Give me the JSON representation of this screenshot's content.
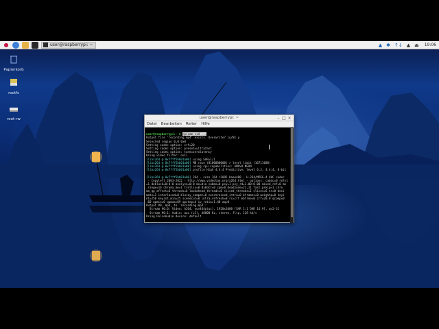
{
  "taskbar": {
    "task_label": "user@raspberrypi: ~",
    "clock": "19:06",
    "tray_icons": [
      "network-icon",
      "bluetooth-icon",
      "wifi-icon",
      "volume-icon",
      "eject-icon"
    ]
  },
  "desktop_icons": [
    {
      "label": "Papierkorb",
      "icon": "trash-icon"
    },
    {
      "label": "rootfs",
      "icon": "drive-icon"
    },
    {
      "label": "root-rw",
      "icon": "drive-icon"
    }
  ],
  "terminal": {
    "title": "user@raspberrypi: ~",
    "menu": [
      "Datei",
      "Bearbeiten",
      "Reiter",
      "Hilfe"
    ],
    "prompt": "user@raspberrypi:~ $",
    "command": "rpicam-vid ...",
    "lines": [
      "Output file 'recording.mp4' exists. Overwrite? [y/N] y",
      "Selected region 0,0 0x0",
      "Setting codec option: crf=20",
      "Setting codec option: preset=ultrafast",
      "Setting codec option: tune=zerolatency",
      "Using video filter: null"
    ],
    "libx264_lines": [
      {
        "prefix": "[libx264 @ 0x7fff5bb01a00]",
        "text": " using SAR=1/1"
      },
      {
        "prefix": "[libx264 @ 0x7fff5bb01a00]",
        "text": " MB rate (8100000000) > level limit (16711680)"
      },
      {
        "prefix": "[libx264 @ 0x7fff5bb01a00]",
        "text": " using cpu capabilities: ARMv8 NEON"
      },
      {
        "prefix": "[libx264 @ 0x7fff5bb01a00]",
        "text": " profile High 4:4:4 Predictive, level 6.2, 4:4:4, 8-bit"
      }
    ],
    "libx264_option_lines": [
      {
        "prefix": "[libx264 @ 0x7fff5bb01a00]",
        "text": " 264 - core 164 r3095 baee400 - H.264/MPEG-4 AVC codec"
      },
      {
        "prefix": "",
        "text": " - Copyleft 2003-2022 - http://www.videolan.org/x264.html - options: cabac=0 ref=1"
      },
      {
        "prefix": "",
        "text": "=1 deblock=0:0:0 analyse=0:0 me=dia subme=0 psy=1 psy_rd=1.00:0.00 mixed_ref=0 me"
      },
      {
        "prefix": "",
        "text": "_range=16 chroma_me=1 trellis=0 8x8dct=0 cqm=0 deadzone=21,11 fast_pskip=1 chro"
      },
      {
        "prefix": "",
        "text": "ma_qp_offset=6 threads=6 lookahead_threads=6 sliced_threads=1 slices=6 nr=0 deci"
      },
      {
        "prefix": "",
        "text": "mate=1 interlaced=0 bluray_compat=0 constrained_intra=0 bframes=0 weightp=0 keyi"
      },
      {
        "prefix": "",
        "text": "nt=250 keyint_min=25 scenecut=0 intra_refresh=0 rc=crf mbtree=0 crf=20.0 qcomp=0"
      },
      {
        "prefix": "",
        "text": ".60 qpmin=0 qpmax=69 qpstep=4 ip_ratio=1.40 aq=0"
      },
      {
        "prefix": "",
        "text": "Output #0, mp4, to 'recording.mp4':"
      },
      {
        "prefix": "",
        "text": "  Stream #0:0: Video: h264, yuv444p(pc), 1920x1080 [SAR 1:1 DAR 16:9], q=2-31"
      },
      {
        "prefix": "",
        "text": "  Stream #0:1: Audio: aac (LC), 48000 Hz, stereo, fltp, 128 kb/s"
      },
      {
        "prefix": "",
        "text": "Using PulseAudio device: default"
      }
    ]
  }
}
